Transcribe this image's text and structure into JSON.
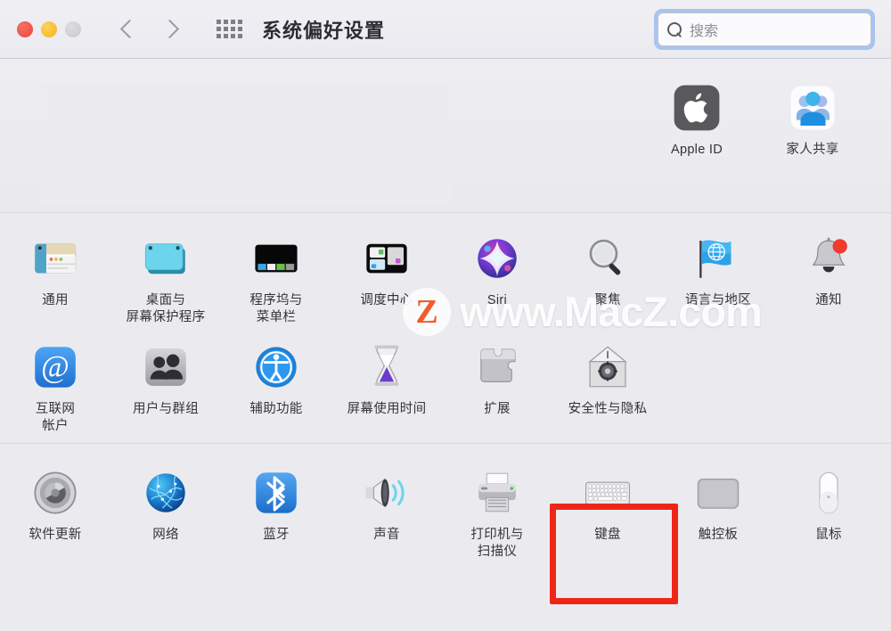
{
  "window": {
    "title": "系统偏好设置",
    "traffic_lights": [
      "close",
      "minimize",
      "zoom"
    ],
    "nav_back": "back-arrow",
    "nav_forward": "forward-arrow",
    "show_all": "grid-icon"
  },
  "search": {
    "placeholder": "搜索",
    "value": "",
    "icon": "search-icon",
    "focus_ring_color": "#a9c4ef"
  },
  "top_section": {
    "items": [
      {
        "label": "Apple ID",
        "icon": "apple-id-icon"
      },
      {
        "label": "家人共享",
        "icon": "family-sharing-icon"
      }
    ]
  },
  "rows": [
    {
      "id": "row-1",
      "items": [
        {
          "label": "通用",
          "icon": "general-icon"
        },
        {
          "label": "桌面与\n屏幕保护程序",
          "icon": "desktop-screensaver-icon"
        },
        {
          "label": "程序坞与\n菜单栏",
          "icon": "dock-menubar-icon"
        },
        {
          "label": "调度中心",
          "icon": "mission-control-icon"
        },
        {
          "label": "Siri",
          "icon": "siri-icon"
        },
        {
          "label": "聚焦",
          "icon": "spotlight-icon"
        },
        {
          "label": "语言与地区",
          "icon": "language-region-icon"
        },
        {
          "label": "通知",
          "icon": "notifications-icon"
        }
      ]
    },
    {
      "id": "row-2",
      "items": [
        {
          "label": "互联网\n帐户",
          "icon": "internet-accounts-icon"
        },
        {
          "label": "用户与群组",
          "icon": "users-groups-icon"
        },
        {
          "label": "辅助功能",
          "icon": "accessibility-icon"
        },
        {
          "label": "屏幕使用时间",
          "icon": "screen-time-icon"
        },
        {
          "label": "扩展",
          "icon": "extensions-icon"
        },
        {
          "label": "安全性与隐私",
          "icon": "security-privacy-icon"
        }
      ]
    },
    {
      "id": "row-3",
      "items": [
        {
          "label": "软件更新",
          "icon": "software-update-icon"
        },
        {
          "label": "网络",
          "icon": "network-icon"
        },
        {
          "label": "蓝牙",
          "icon": "bluetooth-icon"
        },
        {
          "label": "声音",
          "icon": "sound-icon"
        },
        {
          "label": "打印机与\n扫描仪",
          "icon": "printers-scanners-icon"
        },
        {
          "label": "键盘",
          "icon": "keyboard-icon"
        },
        {
          "label": "触控板",
          "icon": "trackpad-icon"
        },
        {
          "label": "鼠标",
          "icon": "mouse-icon"
        }
      ]
    }
  ],
  "annotation": {
    "target_label": "键盘",
    "color": "#ef2617",
    "shape": "rectangle-outline"
  },
  "watermark": {
    "badge_letter": "Z",
    "text": "www.MacZ.com"
  },
  "colors": {
    "window_background": "#ebebef",
    "titlebar_background": "#f0f0f4",
    "label_text": "#333339",
    "accent_red": "#ef2617",
    "focus_blue": "#a9c4ef"
  }
}
